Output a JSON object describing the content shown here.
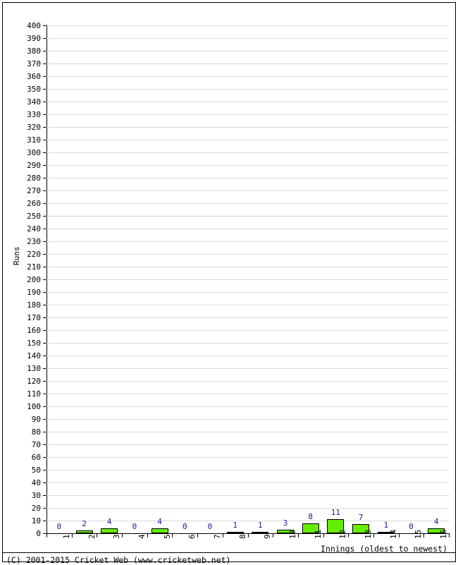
{
  "chart_data": {
    "type": "bar",
    "title": "",
    "xlabel": "Innings (oldest to newest)",
    "ylabel": "Runs",
    "categories": [
      "1",
      "2",
      "3",
      "4",
      "5",
      "6",
      "7",
      "8",
      "9",
      "10",
      "11",
      "12",
      "13",
      "14",
      "15",
      "16"
    ],
    "values": [
      0,
      2,
      4,
      0,
      4,
      0,
      0,
      1,
      1,
      3,
      8,
      11,
      7,
      1,
      0,
      4
    ],
    "ylim": [
      0,
      400
    ],
    "ytick_step": 10,
    "yticks": [
      0,
      10,
      20,
      30,
      40,
      50,
      60,
      70,
      80,
      90,
      100,
      110,
      120,
      130,
      140,
      150,
      160,
      170,
      180,
      190,
      200,
      210,
      220,
      230,
      240,
      250,
      260,
      270,
      280,
      290,
      300,
      310,
      320,
      330,
      340,
      350,
      360,
      370,
      380,
      390,
      400
    ],
    "grid": true,
    "legend": "none",
    "bar_color": "#66EE00",
    "bar_border_color": "#000000",
    "data_label_color": "#1a1aa8",
    "gridline_color": "#d9d9d9",
    "axis_color": "#000000",
    "data_labels_shown": true
  },
  "footer": {
    "copyright": "(C) 2001-2015 Cricket Web (www.cricketweb.net)"
  }
}
